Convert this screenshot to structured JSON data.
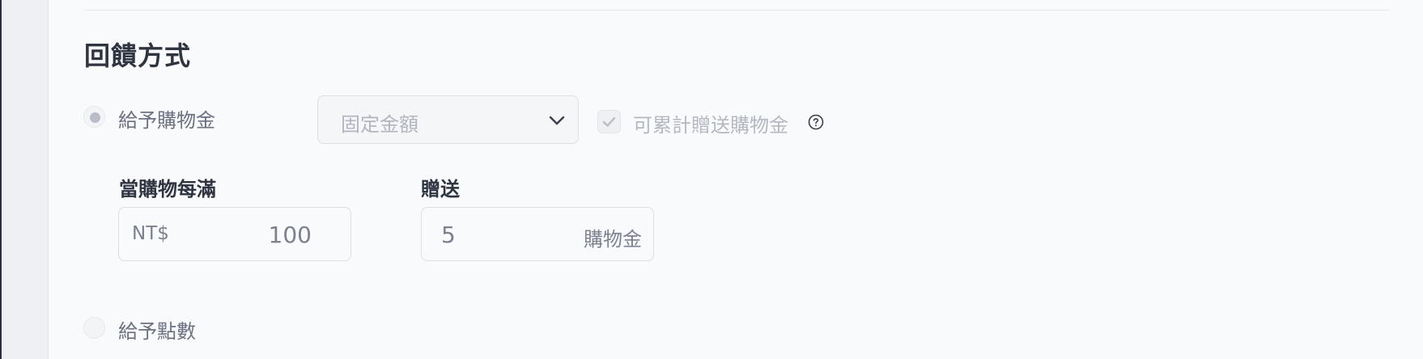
{
  "section": {
    "title": "回饋方式"
  },
  "option_credit": {
    "label": "給予購物金",
    "selected": true,
    "amount_type": {
      "value": "固定金額",
      "icon": "chevron-down-icon"
    },
    "cumulative": {
      "label": "可累計贈送購物金",
      "checked": true,
      "help_icon": "question-circle-icon"
    },
    "threshold": {
      "label": "當購物每滿",
      "prefix": "NT$",
      "value": "100"
    },
    "reward": {
      "label": "贈送",
      "value": "5",
      "suffix": "購物金"
    }
  },
  "option_points": {
    "label": "給予點數",
    "selected": false
  }
}
